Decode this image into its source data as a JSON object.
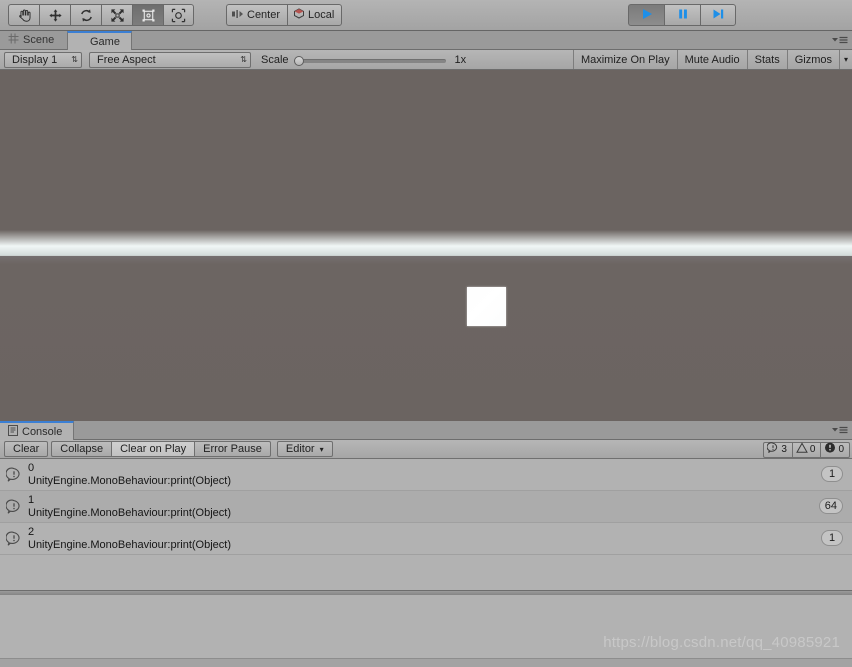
{
  "toolbar": {
    "tools": [
      {
        "name": "hand-tool",
        "icon": "hand-icon",
        "active": false
      },
      {
        "name": "move-tool",
        "icon": "move-icon",
        "active": false
      },
      {
        "name": "rotate-tool",
        "icon": "rotate-icon",
        "active": false
      },
      {
        "name": "scale-tool",
        "icon": "scale-icon",
        "active": false
      },
      {
        "name": "rect-tool",
        "icon": "rect-transform-icon",
        "active": true
      },
      {
        "name": "transform-tool",
        "icon": "transform-icon",
        "active": false
      }
    ],
    "pivot_mode": "Center",
    "pivot_rotation": "Local",
    "play_controls": [
      {
        "name": "play-button",
        "icon": "play-icon",
        "active": true
      },
      {
        "name": "pause-button",
        "icon": "pause-icon",
        "active": false
      },
      {
        "name": "step-button",
        "icon": "step-icon",
        "active": false
      }
    ]
  },
  "game_panel": {
    "tabs": [
      {
        "label": "Scene",
        "icon": "scene-icon",
        "active": false
      },
      {
        "label": "Game",
        "icon": "game-icon",
        "active": true
      }
    ],
    "display": "Display 1",
    "aspect": "Free Aspect",
    "scale_label": "Scale",
    "scale_value": "1x",
    "right_buttons": [
      "Maximize On Play",
      "Mute Audio",
      "Stats",
      "Gizmos"
    ],
    "gizmos_caret": "▾",
    "search_fab_icon": "search-icon"
  },
  "console_panel": {
    "tab": {
      "label": "Console",
      "icon": "console-icon"
    },
    "buttons": [
      {
        "label": "Clear",
        "pressed": false
      },
      {
        "label": "Collapse",
        "pressed": false
      },
      {
        "label": "Clear on Play",
        "pressed": true
      },
      {
        "label": "Error Pause",
        "pressed": false
      },
      {
        "label": "Editor",
        "pressed": false,
        "caret": "▾"
      }
    ],
    "filters": [
      {
        "icon": "log-icon",
        "count": "3"
      },
      {
        "icon": "warning-icon",
        "count": "0"
      },
      {
        "icon": "error-icon",
        "count": "0"
      }
    ],
    "rows": [
      {
        "message": "0",
        "stack": "UnityEngine.MonoBehaviour:print(Object)",
        "icon": "log-icon",
        "count": "1"
      },
      {
        "message": "1",
        "stack": "UnityEngine.MonoBehaviour:print(Object)",
        "icon": "log-icon",
        "count": "64"
      },
      {
        "message": "2",
        "stack": "UnityEngine.MonoBehaviour:print(Object)",
        "icon": "log-icon",
        "count": "1"
      }
    ]
  },
  "watermark": "https://blog.csdn.net/qq_40985921",
  "colors": {
    "accent_blue": "#3b7fd4",
    "play_blue": "#1e8fe8",
    "fab_red": "#b0504b",
    "chrome_gray": "#a5a5a5",
    "panel_gray": "#b2b2b2",
    "ground": "#6b6461"
  }
}
